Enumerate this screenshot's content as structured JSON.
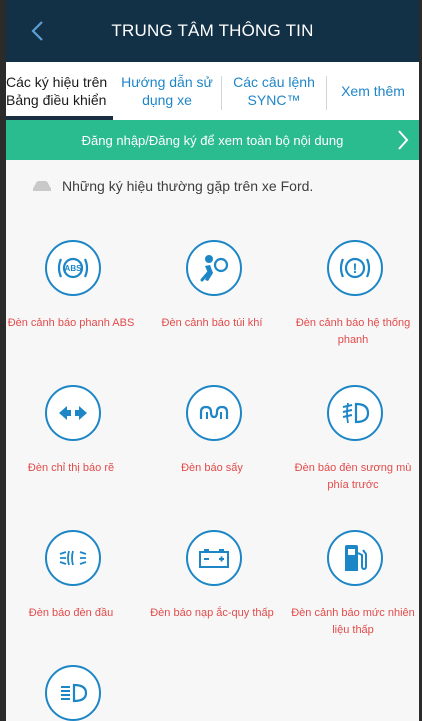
{
  "header": {
    "title": "TRUNG TÂM THÔNG TIN"
  },
  "tabs": [
    {
      "label_line1": "Các ký hiệu trên",
      "label_line2": "Bảng điều khiển",
      "active": true
    },
    {
      "label_line1": "Hướng dẫn sử",
      "label_line2": "dụng xe",
      "active": false
    },
    {
      "label_line1": "Các câu lệnh",
      "label_line2": "SYNC™",
      "active": false
    },
    {
      "label_line1": "Xem thêm",
      "label_line2": "",
      "active": false
    }
  ],
  "banner": {
    "text": "Đăng nhập/Đăng ký để xem toàn bộ nội dung"
  },
  "intro": {
    "text": "Những ký hiệu thường gặp trên xe Ford."
  },
  "symbols": [
    {
      "icon": "abs-icon",
      "label": "Đèn cảnh báo phanh ABS",
      "icon_text": "ABS"
    },
    {
      "icon": "airbag-icon",
      "label": "Đèn cảnh báo túi khí",
      "icon_text": ""
    },
    {
      "icon": "brake-system-icon",
      "label": "Đèn cảnh báo hệ thống phanh",
      "icon_text": "!"
    },
    {
      "icon": "turn-signal-icon",
      "label": "Đèn chỉ thị báo rẽ",
      "icon_text": ""
    },
    {
      "icon": "glow-plug-icon",
      "label": "Đèn báo sấy",
      "icon_text": ""
    },
    {
      "icon": "front-fog-lamp-icon",
      "label": "Đèn báo đèn sương mù phía trước",
      "icon_text": ""
    },
    {
      "icon": "headlamp-icon",
      "label": "Đèn báo đèn đầu",
      "icon_text": ""
    },
    {
      "icon": "battery-charge-icon",
      "label": "Đèn báo nạp ắc-quy thấp",
      "icon_text": ""
    },
    {
      "icon": "low-fuel-icon",
      "label": "Đèn cảnh báo mức nhiên liệu thấp",
      "icon_text": ""
    },
    {
      "icon": "high-beam-icon",
      "label": "",
      "icon_text": ""
    }
  ],
  "colors": {
    "header_bg": "#123046",
    "accent_blue": "#1d86c6",
    "banner_green": "#2abb8f",
    "label_red": "#e24b4b"
  }
}
